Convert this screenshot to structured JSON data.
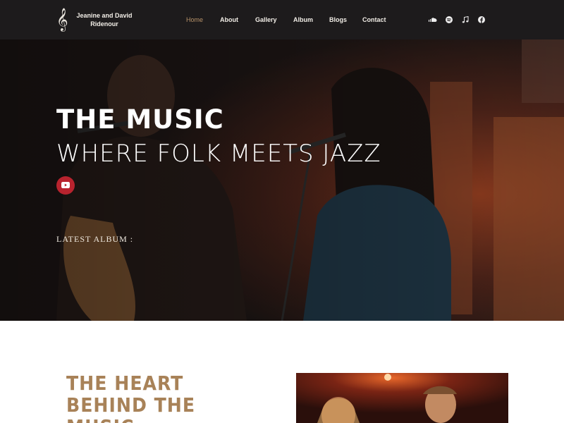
{
  "brand": {
    "line1": "Jeanine and David",
    "line2": "Ridenour",
    "logo_icon": "treble-clef-icon"
  },
  "nav": {
    "items": [
      {
        "label": "Home",
        "active": true
      },
      {
        "label": "About",
        "active": false
      },
      {
        "label": "Gallery",
        "active": false
      },
      {
        "label": "Album",
        "active": false
      },
      {
        "label": "Blogs",
        "active": false
      },
      {
        "label": "Contact",
        "active": false
      }
    ],
    "social_icons": [
      "soundcloud-icon",
      "spotify-icon",
      "music-note-icon",
      "facebook-icon"
    ]
  },
  "hero": {
    "title": "THE MUSIC",
    "subtitle": "WHERE FOLK MEETS JAZZ",
    "video_icon": "youtube-icon",
    "latest_album_label": "LATEST ALBUM :"
  },
  "about": {
    "heading_lines": [
      "THE HEART",
      "BEHIND THE",
      "MUSIC"
    ]
  },
  "colors": {
    "nav_bg": "#1d1b1c",
    "accent": "#b8936a",
    "heading_gold": "#a88258",
    "youtube_red": "#b8232e"
  }
}
